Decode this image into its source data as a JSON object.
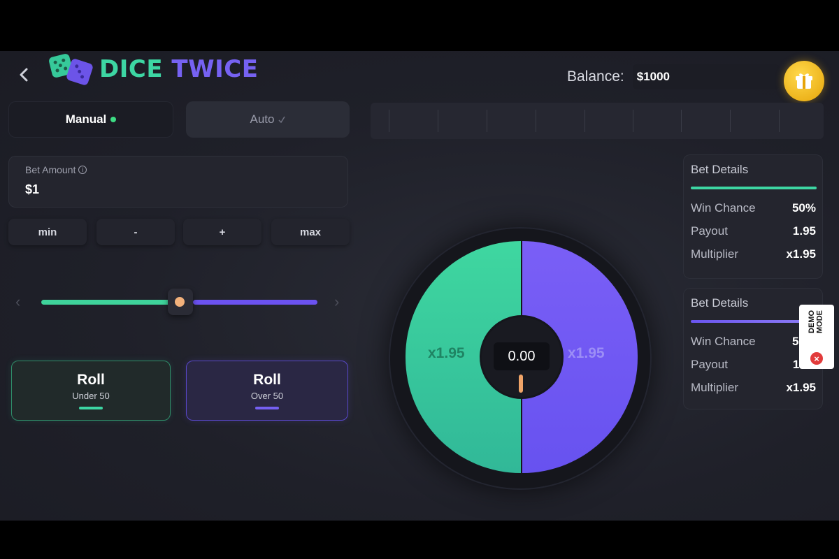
{
  "header": {
    "back_icon": "chevron-left-icon",
    "logo_word1": "DICE",
    "logo_word2": "TWICE",
    "balance_label": "Balance:",
    "balance_value": "$1000",
    "gift_icon": "gift-icon"
  },
  "tabs": {
    "manual_label": "Manual",
    "auto_label": "Auto"
  },
  "bet": {
    "label": "Bet Amount",
    "value": "$1",
    "buttons": {
      "min": "min",
      "minus": "-",
      "plus": "+",
      "max": "max"
    }
  },
  "slider": {
    "value_fraction": 0.5
  },
  "roll_under": {
    "title": "Roll",
    "subtitle": "Under 50"
  },
  "roll_over": {
    "title": "Roll",
    "subtitle": "Over 50"
  },
  "wheel": {
    "readout": "0.00",
    "left_multiplier": "x1.95",
    "right_multiplier": "x1.95"
  },
  "details_under": {
    "title": "Bet Details",
    "win_chance_label": "Win Chance",
    "win_chance_value": "50%",
    "payout_label": "Payout",
    "payout_value": "1.95",
    "multiplier_label": "Multiplier",
    "multiplier_value": "x1.95"
  },
  "details_over": {
    "title": "Bet Details",
    "win_chance_label": "Win Chance",
    "win_chance_value": "50%",
    "payout_label": "Payout",
    "payout_value": "1.95",
    "multiplier_label": "Multiplier",
    "multiplier_value": "x1.95"
  },
  "demo_badge": {
    "line1": "DEMO",
    "line2": "MODE"
  },
  "colors": {
    "green": "#3dd6a3",
    "purple": "#6b52f0",
    "gold": "#f5c21a",
    "background": "#1f2029"
  }
}
